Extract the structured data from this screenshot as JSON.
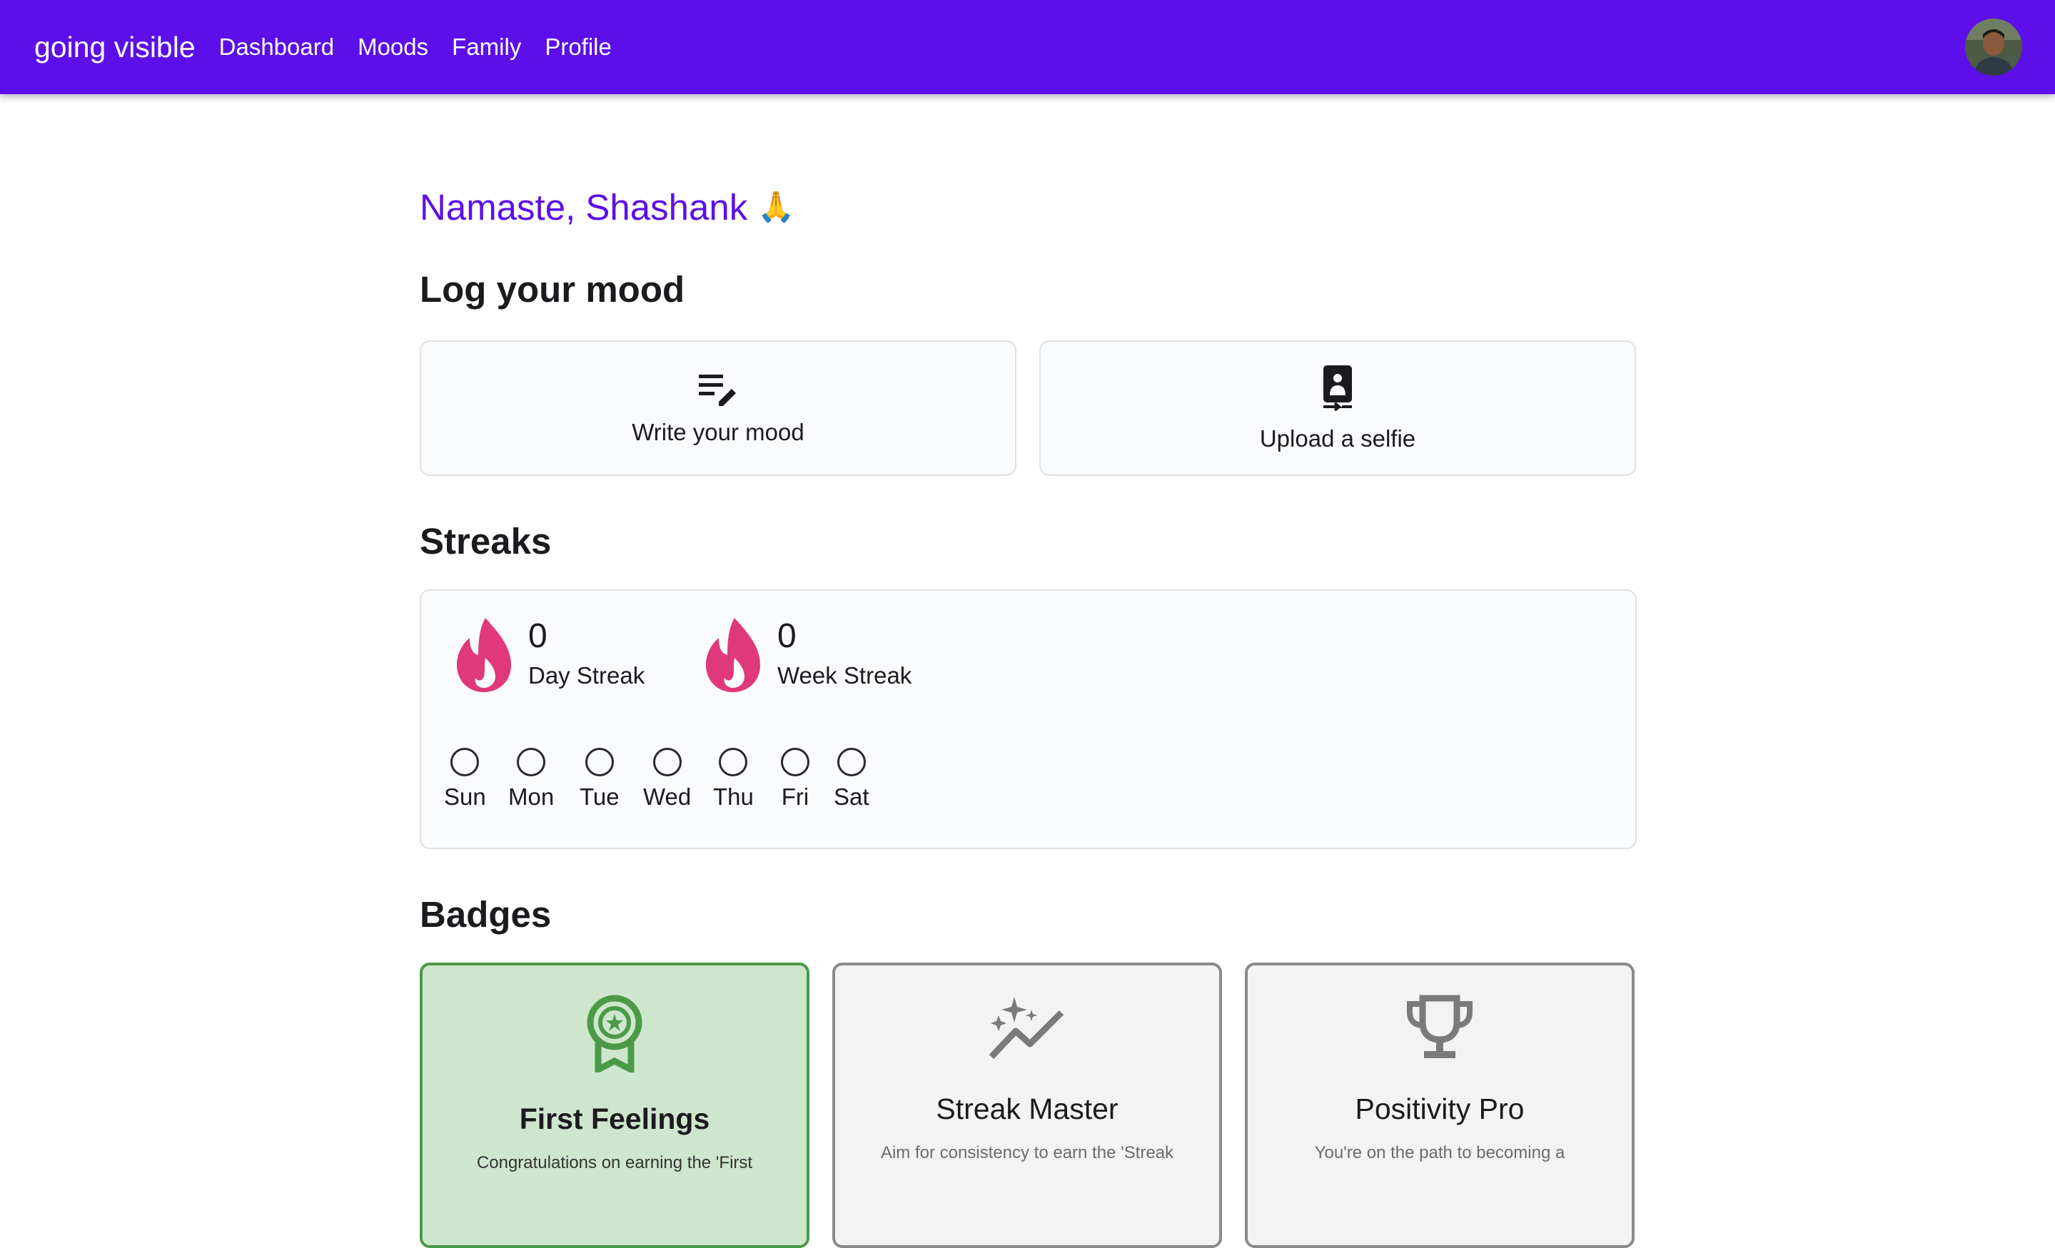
{
  "appbar": {
    "brand": "going visible",
    "nav": [
      {
        "label": "Dashboard"
      },
      {
        "label": "Moods"
      },
      {
        "label": "Family"
      },
      {
        "label": "Profile"
      }
    ],
    "color": "#5c0fe8"
  },
  "greeting": {
    "text": "Namaste, Shashank",
    "emoji": "🙏"
  },
  "log_mood": {
    "title": "Log your mood",
    "actions": [
      {
        "label": "Write your mood",
        "icon": "edit-note-icon"
      },
      {
        "label": "Upload a selfie",
        "icon": "camera-front-icon"
      }
    ]
  },
  "streaks": {
    "title": "Streaks",
    "day": {
      "count": "0",
      "label": "Day Streak",
      "icon": "flame-icon"
    },
    "week": {
      "count": "0",
      "label": "Week Streak",
      "icon": "flame-icon"
    },
    "days": [
      "Sun",
      "Mon",
      "Tue",
      "Wed",
      "Thu",
      "Fri",
      "Sat"
    ],
    "flame_color": "#e0397a"
  },
  "badges": {
    "title": "Badges",
    "items": [
      {
        "title": "First Feelings",
        "desc": "Congratulations on earning the 'First",
        "icon": "award-icon",
        "earned": true
      },
      {
        "title": "Streak Master",
        "desc": "Aim for consistency to earn the 'Streak",
        "icon": "sparkle-trend-icon",
        "earned": false
      },
      {
        "title": "Positivity Pro",
        "desc": "You're on the path to becoming a",
        "icon": "trophy-icon",
        "earned": false
      }
    ],
    "earned_color": "#4b9a48"
  }
}
